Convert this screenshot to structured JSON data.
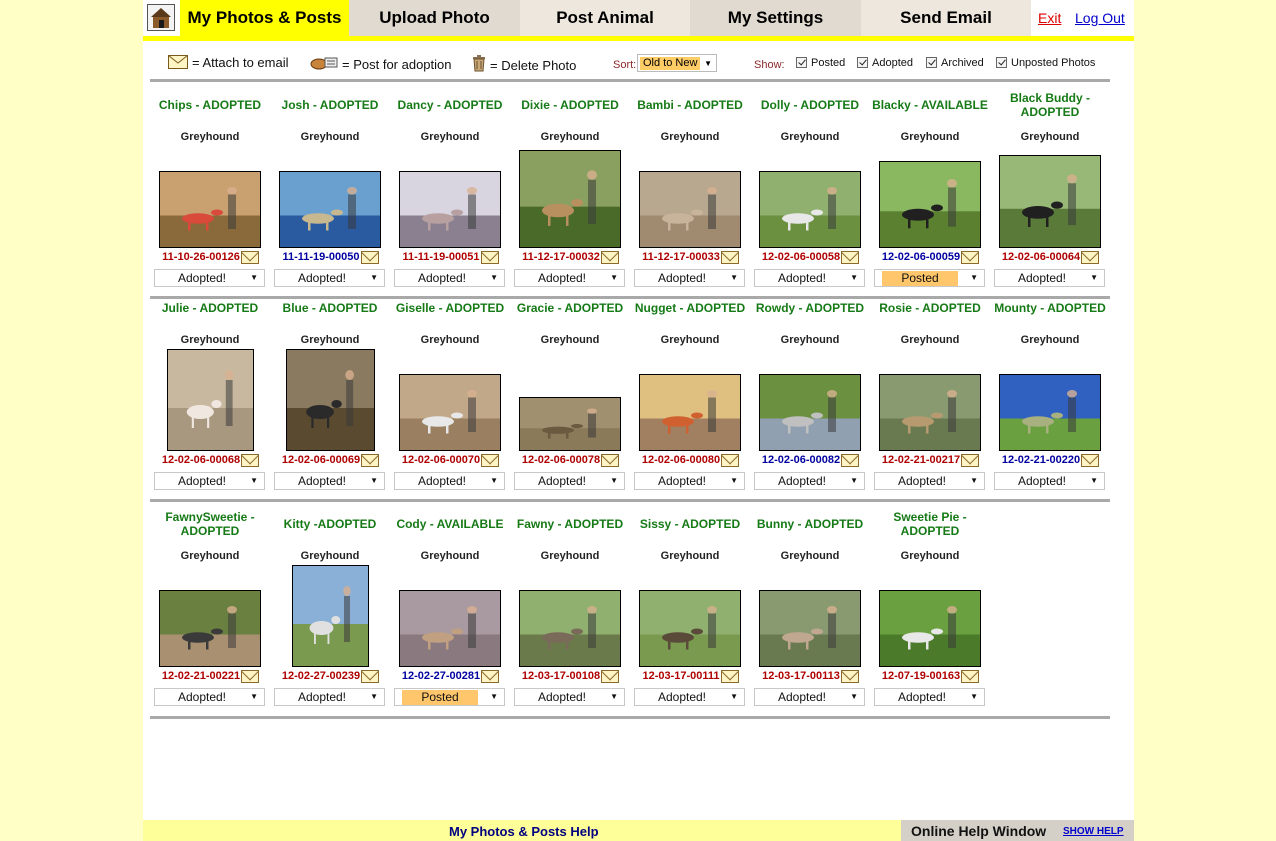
{
  "nav": {
    "tabs": [
      "My Photos & Posts",
      "Upload Photo",
      "Post Animal",
      "My Settings",
      "Send Email"
    ],
    "exit": "Exit",
    "logout": "Log Out"
  },
  "legend": {
    "attach": "= Attach to email",
    "post": "= Post for adoption",
    "delete": "= Delete Photo",
    "sort_label": "Sort:",
    "sort_value": "Old to New",
    "show_label": "Show:",
    "filters": [
      "Posted",
      "Adopted",
      "Archived",
      "Unposted Photos"
    ]
  },
  "rows": [
    [
      {
        "title": "Chips - ADOPTED",
        "breed": "Greyhound",
        "code": "11-10-26-00126",
        "code_color": "red",
        "status": "Adopted!"
      },
      {
        "title": "Josh - ADOPTED",
        "breed": "Greyhound",
        "code": "11-11-19-00050",
        "code_color": "blue",
        "status": "Adopted!"
      },
      {
        "title": "Dancy - ADOPTED",
        "breed": "Greyhound",
        "code": "11-11-19-00051",
        "code_color": "red",
        "status": "Adopted!"
      },
      {
        "title": "Dixie - ADOPTED",
        "breed": "Greyhound",
        "code": "11-12-17-00032",
        "code_color": "red",
        "status": "Adopted!"
      },
      {
        "title": "Bambi - ADOPTED",
        "breed": "Greyhound",
        "code": "11-12-17-00033",
        "code_color": "red",
        "status": "Adopted!"
      },
      {
        "title": "Dolly - ADOPTED",
        "breed": "Greyhound",
        "code": "12-02-06-00058",
        "code_color": "red",
        "status": "Adopted!"
      },
      {
        "title": "Blacky - AVAILABLE",
        "breed": "Greyhound",
        "code": "12-02-06-00059",
        "code_color": "blue",
        "status": "Posted"
      },
      {
        "title": "Black Buddy - ADOPTED",
        "breed": "Greyhound",
        "code": "12-02-06-00064",
        "code_color": "red",
        "status": "Adopted!"
      }
    ],
    [
      {
        "title": "Julie - ADOPTED",
        "breed": "Greyhound",
        "code": "12-02-06-00068",
        "code_color": "red",
        "status": "Adopted!"
      },
      {
        "title": "Blue - ADOPTED",
        "breed": "Greyhound",
        "code": "12-02-06-00069",
        "code_color": "red",
        "status": "Adopted!"
      },
      {
        "title": "Giselle - ADOPTED",
        "breed": "Greyhound",
        "code": "12-02-06-00070",
        "code_color": "red",
        "status": "Adopted!"
      },
      {
        "title": "Gracie - ADOPTED",
        "breed": "Greyhound",
        "code": "12-02-06-00078",
        "code_color": "red",
        "status": "Adopted!"
      },
      {
        "title": "Nugget - ADOPTED",
        "breed": "Greyhound",
        "code": "12-02-06-00080",
        "code_color": "red",
        "status": "Adopted!"
      },
      {
        "title": "Rowdy - ADOPTED",
        "breed": "Greyhound",
        "code": "12-02-06-00082",
        "code_color": "blue",
        "status": "Adopted!"
      },
      {
        "title": "Rosie - ADOPTED",
        "breed": "Greyhound",
        "code": "12-02-21-00217",
        "code_color": "red",
        "status": "Adopted!"
      },
      {
        "title": "Mounty - ADOPTED",
        "breed": "Greyhound",
        "code": "12-02-21-00220",
        "code_color": "blue",
        "status": "Adopted!"
      }
    ],
    [
      {
        "title": "FawnySweetie - ADOPTED",
        "breed": "Greyhound",
        "code": "12-02-21-00221",
        "code_color": "red",
        "status": "Adopted!"
      },
      {
        "title": "Kitty -ADOPTED",
        "breed": "Greyhound",
        "code": "12-02-27-00239",
        "code_color": "red",
        "status": "Adopted!"
      },
      {
        "title": "Cody - AVAILABLE",
        "breed": "Greyhound",
        "code": "12-02-27-00281",
        "code_color": "blue",
        "status": "Posted"
      },
      {
        "title": "Fawny - ADOPTED",
        "breed": "Greyhound",
        "code": "12-03-17-00108",
        "code_color": "red",
        "status": "Adopted!"
      },
      {
        "title": "Sissy - ADOPTED",
        "breed": "Greyhound",
        "code": "12-03-17-00111",
        "code_color": "red",
        "status": "Adopted!"
      },
      {
        "title": "Bunny - ADOPTED",
        "breed": "Greyhound",
        "code": "12-03-17-00113",
        "code_color": "red",
        "status": "Adopted!"
      },
      {
        "title": "Sweetie Pie - ADOPTED",
        "breed": "Greyhound",
        "code": "12-07-19-00163",
        "code_color": "red",
        "status": "Adopted!"
      }
    ]
  ],
  "footer": {
    "help_title": "My Photos & Posts Help",
    "help_window": "Online Help Window",
    "show_help": "SHOW HELP"
  }
}
